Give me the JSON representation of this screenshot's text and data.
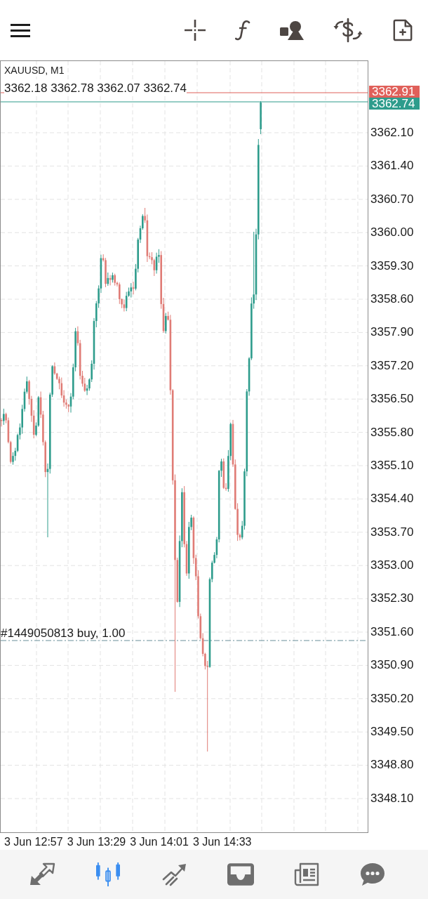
{
  "chart": {
    "symbol": "XAUUSD, M1",
    "ohlc": "3362.18 3362.78 3362.07 3362.74",
    "order_label": "#1449050813 buy, 1.00",
    "price_tags": [
      {
        "label": "3362.91",
        "color": "#e0605a"
      },
      {
        "label": "3362.74",
        "color": "#2e9c8c"
      }
    ],
    "price_axis": [
      "3362.10",
      "3361.40",
      "3360.70",
      "3360.00",
      "3359.30",
      "3358.60",
      "3357.90",
      "3357.20",
      "3356.50",
      "3355.80",
      "3355.10",
      "3354.40",
      "3353.70",
      "3353.00",
      "3352.30",
      "3351.60",
      "3350.90",
      "3350.20",
      "3349.50",
      "3348.80",
      "3348.10"
    ],
    "time_axis": [
      "3 Jun 12:57",
      "3 Jun 13:29",
      "3 Jun 14:01",
      "3 Jun 14:33"
    ]
  },
  "bottom_nav": {
    "items": [
      {
        "selected": false
      },
      {
        "selected": true
      },
      {
        "selected": false
      },
      {
        "selected": false
      },
      {
        "selected": false
      },
      {
        "selected": false
      }
    ]
  }
}
